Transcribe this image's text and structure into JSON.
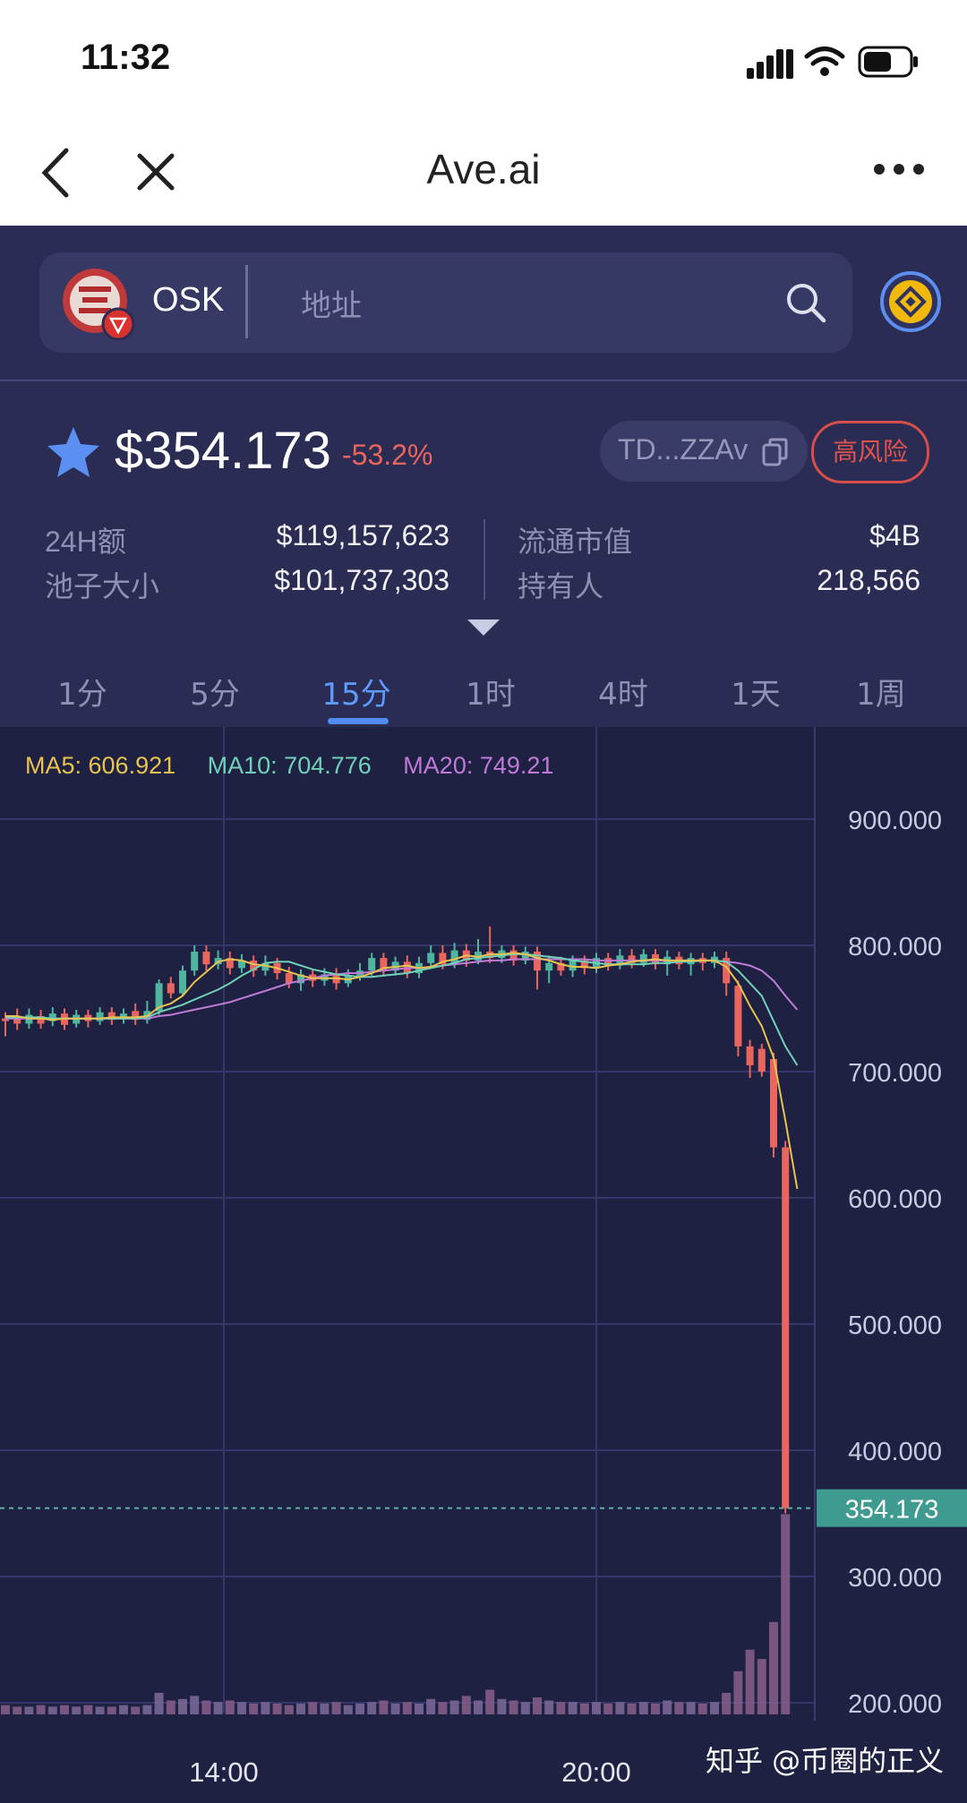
{
  "status_bar": {
    "time": "11:32"
  },
  "browser": {
    "title": "Ave.ai"
  },
  "token": {
    "symbol": "OSK",
    "search_placeholder": "地址",
    "price": "$354.173",
    "change": "-53.2%",
    "address": "TD...ZZAv",
    "risk_label": "高风险"
  },
  "stats": {
    "volume_24h_label": "24H额",
    "volume_24h_value": "$119,157,623",
    "pool_label": "池子大小",
    "pool_value": "$101,737,303",
    "market_cap_label": "流通市值",
    "market_cap_value": "$4B",
    "holders_label": "持有人",
    "holders_value": "218,566"
  },
  "timeframes": [
    "1分",
    "5分",
    "15分",
    "1时",
    "4时",
    "1天",
    "1周"
  ],
  "active_timeframe_index": 2,
  "indicators": {
    "ma5": "MA5: 606.921",
    "ma10": "MA10: 704.776",
    "ma20": "MA20: 749.21"
  },
  "colors": {
    "up": "#4fb59e",
    "down": "#e8665e",
    "ma5": "#e8c34f",
    "ma10": "#6fd2b8",
    "ma20": "#c07ad8",
    "accent": "#4f8cf7"
  },
  "watermark": "知乎 @币圈的正义",
  "chart_data": {
    "type": "candlestick",
    "y_tick_labels": [
      "900.000",
      "800.000",
      "700.000",
      "600.000",
      "500.000",
      "400.000",
      "300.000",
      "200.000"
    ],
    "ylim": [
      190,
      920
    ],
    "x_tick_labels": [
      "14:00",
      "20:00"
    ],
    "current_price_label": "354.173",
    "current_price": 354.173,
    "candles": [
      {
        "o": 742,
        "c": 740,
        "h": 747,
        "l": 728
      },
      {
        "o": 744,
        "c": 738,
        "h": 750,
        "l": 733
      },
      {
        "o": 738,
        "c": 745,
        "h": 750,
        "l": 734
      },
      {
        "o": 744,
        "c": 738,
        "h": 749,
        "l": 734
      },
      {
        "o": 740,
        "c": 746,
        "h": 751,
        "l": 736
      },
      {
        "o": 746,
        "c": 737,
        "h": 750,
        "l": 733
      },
      {
        "o": 738,
        "c": 745,
        "h": 749,
        "l": 735
      },
      {
        "o": 745,
        "c": 740,
        "h": 749,
        "l": 735
      },
      {
        "o": 740,
        "c": 747,
        "h": 751,
        "l": 737
      },
      {
        "o": 747,
        "c": 741,
        "h": 751,
        "l": 737
      },
      {
        "o": 742,
        "c": 746,
        "h": 750,
        "l": 738
      },
      {
        "o": 748,
        "c": 741,
        "h": 754,
        "l": 737
      },
      {
        "o": 741,
        "c": 748,
        "h": 756,
        "l": 738
      },
      {
        "o": 748,
        "c": 770,
        "h": 773,
        "l": 745
      },
      {
        "o": 770,
        "c": 762,
        "h": 775,
        "l": 758
      },
      {
        "o": 762,
        "c": 780,
        "h": 784,
        "l": 760
      },
      {
        "o": 780,
        "c": 795,
        "h": 800,
        "l": 776
      },
      {
        "o": 795,
        "c": 785,
        "h": 800,
        "l": 780
      },
      {
        "o": 785,
        "c": 790,
        "h": 796,
        "l": 781
      },
      {
        "o": 790,
        "c": 782,
        "h": 795,
        "l": 777
      },
      {
        "o": 782,
        "c": 788,
        "h": 793,
        "l": 778
      },
      {
        "o": 788,
        "c": 780,
        "h": 792,
        "l": 775
      },
      {
        "o": 780,
        "c": 786,
        "h": 792,
        "l": 776
      },
      {
        "o": 786,
        "c": 778,
        "h": 790,
        "l": 773
      },
      {
        "o": 778,
        "c": 770,
        "h": 783,
        "l": 766
      },
      {
        "o": 770,
        "c": 777,
        "h": 781,
        "l": 764
      },
      {
        "o": 777,
        "c": 772,
        "h": 781,
        "l": 767
      },
      {
        "o": 772,
        "c": 777,
        "h": 782,
        "l": 768
      },
      {
        "o": 777,
        "c": 770,
        "h": 782,
        "l": 765
      },
      {
        "o": 770,
        "c": 776,
        "h": 781,
        "l": 767
      },
      {
        "o": 776,
        "c": 780,
        "h": 786,
        "l": 772
      },
      {
        "o": 780,
        "c": 790,
        "h": 794,
        "l": 776
      },
      {
        "o": 790,
        "c": 780,
        "h": 794,
        "l": 776
      },
      {
        "o": 780,
        "c": 787,
        "h": 791,
        "l": 776
      },
      {
        "o": 787,
        "c": 778,
        "h": 792,
        "l": 774
      },
      {
        "o": 778,
        "c": 786,
        "h": 791,
        "l": 774
      },
      {
        "o": 786,
        "c": 794,
        "h": 800,
        "l": 782
      },
      {
        "o": 794,
        "c": 785,
        "h": 800,
        "l": 781
      },
      {
        "o": 785,
        "c": 796,
        "h": 802,
        "l": 782
      },
      {
        "o": 796,
        "c": 788,
        "h": 801,
        "l": 783
      },
      {
        "o": 788,
        "c": 795,
        "h": 805,
        "l": 785
      },
      {
        "o": 795,
        "c": 790,
        "h": 815,
        "l": 786
      },
      {
        "o": 790,
        "c": 796,
        "h": 800,
        "l": 786
      },
      {
        "o": 796,
        "c": 788,
        "h": 800,
        "l": 784
      },
      {
        "o": 788,
        "c": 795,
        "h": 799,
        "l": 785
      },
      {
        "o": 795,
        "c": 780,
        "h": 799,
        "l": 765
      },
      {
        "o": 780,
        "c": 786,
        "h": 792,
        "l": 770
      },
      {
        "o": 786,
        "c": 780,
        "h": 791,
        "l": 776
      },
      {
        "o": 780,
        "c": 788,
        "h": 792,
        "l": 775
      },
      {
        "o": 788,
        "c": 782,
        "h": 792,
        "l": 777
      },
      {
        "o": 782,
        "c": 790,
        "h": 794,
        "l": 778
      },
      {
        "o": 790,
        "c": 784,
        "h": 794,
        "l": 780
      },
      {
        "o": 784,
        "c": 792,
        "h": 797,
        "l": 781
      },
      {
        "o": 792,
        "c": 786,
        "h": 797,
        "l": 782
      },
      {
        "o": 786,
        "c": 793,
        "h": 797,
        "l": 783
      },
      {
        "o": 793,
        "c": 785,
        "h": 797,
        "l": 781
      },
      {
        "o": 785,
        "c": 791,
        "h": 796,
        "l": 776
      },
      {
        "o": 791,
        "c": 785,
        "h": 795,
        "l": 781
      },
      {
        "o": 785,
        "c": 790,
        "h": 794,
        "l": 776
      },
      {
        "o": 790,
        "c": 786,
        "h": 794,
        "l": 780
      },
      {
        "o": 786,
        "c": 791,
        "h": 795,
        "l": 782
      },
      {
        "o": 790,
        "c": 770,
        "h": 795,
        "l": 760
      },
      {
        "o": 768,
        "c": 720,
        "h": 772,
        "l": 712
      },
      {
        "o": 720,
        "c": 705,
        "h": 725,
        "l": 695
      },
      {
        "o": 718,
        "c": 700,
        "h": 722,
        "l": 696
      },
      {
        "o": 710,
        "c": 640,
        "h": 715,
        "l": 632
      },
      {
        "o": 640,
        "c": 354,
        "h": 645,
        "l": 350
      }
    ],
    "volume": [
      6,
      5,
      5,
      6,
      5,
      6,
      5,
      6,
      5,
      5,
      6,
      5,
      6,
      14,
      9,
      10,
      12,
      9,
      8,
      9,
      8,
      7,
      8,
      7,
      6,
      7,
      8,
      7,
      8,
      6,
      7,
      8,
      9,
      7,
      8,
      7,
      10,
      8,
      9,
      12,
      9,
      16,
      10,
      9,
      8,
      11,
      9,
      8,
      8,
      7,
      8,
      7,
      8,
      7,
      8,
      7,
      9,
      8,
      8,
      7,
      8,
      14,
      28,
      42,
      36,
      60,
      130
    ],
    "ma5": [
      744,
      744,
      742,
      742,
      741,
      742,
      742,
      742,
      742,
      743,
      743,
      743,
      744,
      751,
      754,
      760,
      771,
      779,
      787,
      789,
      788,
      785,
      784,
      782,
      779,
      776,
      774,
      774,
      774,
      773,
      775,
      778,
      782,
      783,
      784,
      782,
      783,
      787,
      789,
      792,
      791,
      793,
      793,
      794,
      793,
      790,
      788,
      785,
      783,
      783,
      782,
      784,
      785,
      787,
      788,
      789,
      788,
      788,
      788,
      788,
      788,
      783,
      770,
      752,
      736,
      711,
      661,
      607
    ],
    "ma10": [
      743,
      743,
      743,
      743,
      742,
      742,
      742,
      742,
      742,
      742,
      742,
      742,
      743,
      747,
      750,
      753,
      757,
      761,
      765,
      770,
      776,
      781,
      786,
      787,
      787,
      784,
      781,
      779,
      777,
      776,
      775,
      775,
      776,
      777,
      778,
      780,
      782,
      784,
      786,
      789,
      790,
      791,
      792,
      793,
      793,
      792,
      791,
      790,
      788,
      787,
      786,
      785,
      785,
      785,
      785,
      786,
      786,
      787,
      787,
      788,
      788,
      787,
      780,
      770,
      760,
      740,
      720,
      705
    ],
    "ma20": [
      742,
      742,
      742,
      742,
      742,
      742,
      742,
      742,
      742,
      742,
      742,
      742,
      742,
      744,
      745,
      747,
      749,
      751,
      753,
      755,
      758,
      761,
      764,
      767,
      770,
      772,
      774,
      776,
      777,
      778,
      778,
      779,
      780,
      781,
      782,
      782,
      783,
      784,
      785,
      786,
      787,
      788,
      788,
      789,
      789,
      789,
      789,
      789,
      789,
      789,
      788,
      788,
      788,
      788,
      788,
      788,
      788,
      788,
      788,
      788,
      788,
      787,
      786,
      784,
      780,
      772,
      760,
      749
    ]
  }
}
